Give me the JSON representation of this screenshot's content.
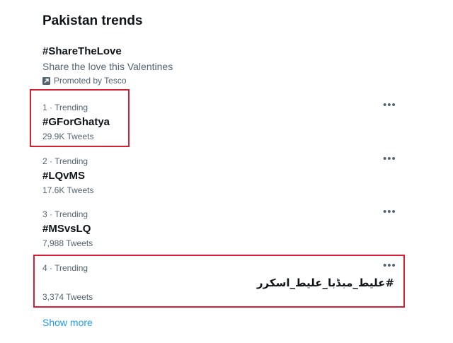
{
  "header": {
    "title": "Pakistan trends"
  },
  "promoted": {
    "hashtag": "#ShareTheLove",
    "description": "Share the love this Valentines",
    "by_label": "Promoted by Tesco",
    "icon": "promoted-arrow-icon"
  },
  "trends": [
    {
      "meta": "1 · Trending",
      "name": "#GForGhatya",
      "count": "29.9K Tweets"
    },
    {
      "meta": "2 · Trending",
      "name": "#LQvMS",
      "count": "17.6K Tweets"
    },
    {
      "meta": "3 · Trending",
      "name": "#MSvsLQ",
      "count": "7,988 Tweets"
    },
    {
      "meta": "4 · Trending",
      "name": "#علیط_مبڈبا_علیط_اسکرر",
      "count": "3,374 Tweets"
    }
  ],
  "more_icon": "•••",
  "show_more": "Show more",
  "colors": {
    "highlight": "#d42032",
    "link": "#1d9bf0",
    "secondary_text": "#536471"
  }
}
